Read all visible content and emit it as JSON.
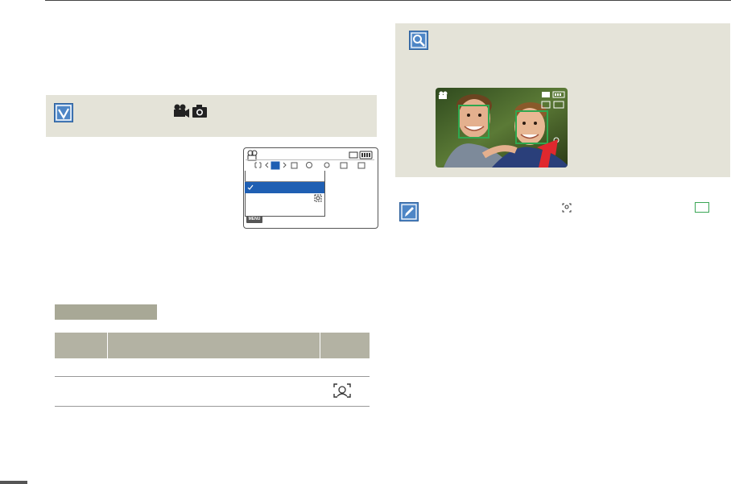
{
  "icons": {
    "check": "check-box-icon",
    "modes": [
      "video-camera-icon",
      "photo-camera-icon"
    ],
    "magnifier": "magnifier-icon",
    "pencil": "pencil-note-icon",
    "face_detection": "face-detection-icon"
  },
  "lcd": {
    "menu_button": "MENU"
  },
  "colors": {
    "note_bg": "#e4e3d8",
    "accent_blue": "#1f5fb3",
    "face_frame_green": "#2fa84f",
    "table_header": "#b3b2a3",
    "arrow_red": "#e0282e"
  }
}
